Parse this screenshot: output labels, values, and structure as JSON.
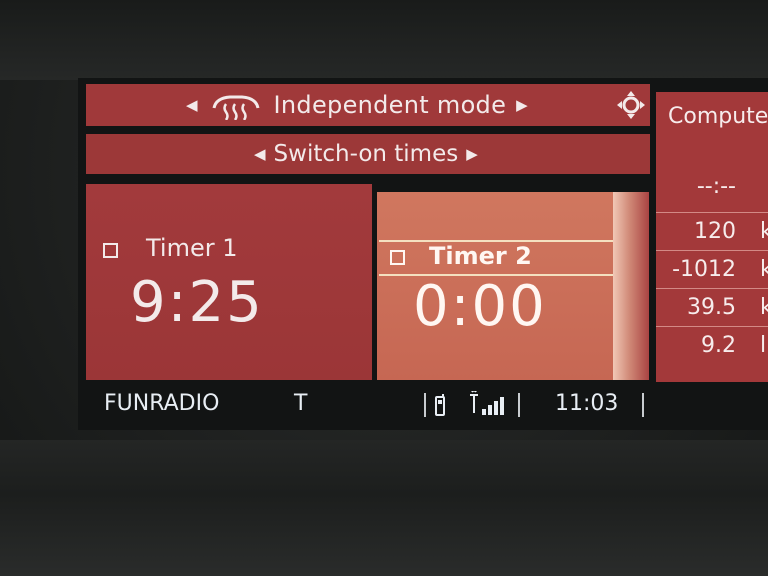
{
  "header": {
    "title": "Independent mode",
    "left_arrow": "◀",
    "right_arrow": "▶",
    "icons": [
      "heater-icon",
      "navigation-joystick-icon"
    ]
  },
  "subheader": {
    "title": "Switch-on times",
    "left_arrow": "◀",
    "right_arrow": "▶"
  },
  "timers": [
    {
      "label": "Timer 1",
      "time": "9:25"
    },
    {
      "label": "Timer 2",
      "time": "0:00"
    }
  ],
  "side_panel": {
    "title": "Compute",
    "values": [
      {
        "value": "--:--",
        "unit": ""
      },
      {
        "value": "120",
        "unit": "kr"
      },
      {
        "value": "-1012",
        "unit": "kr"
      },
      {
        "value": "39.5",
        "unit": "km"
      },
      {
        "value": "9.2",
        "unit": "l"
      }
    ]
  },
  "status": {
    "station": "FUNRADIO",
    "traffic": "T",
    "clock": "11:03",
    "icons": [
      "phone-icon",
      "signal-strength-icon"
    ]
  },
  "colors": {
    "panel": "#a0393a",
    "selected_panel": "#cc715a",
    "status_text": "#e8eef4"
  }
}
